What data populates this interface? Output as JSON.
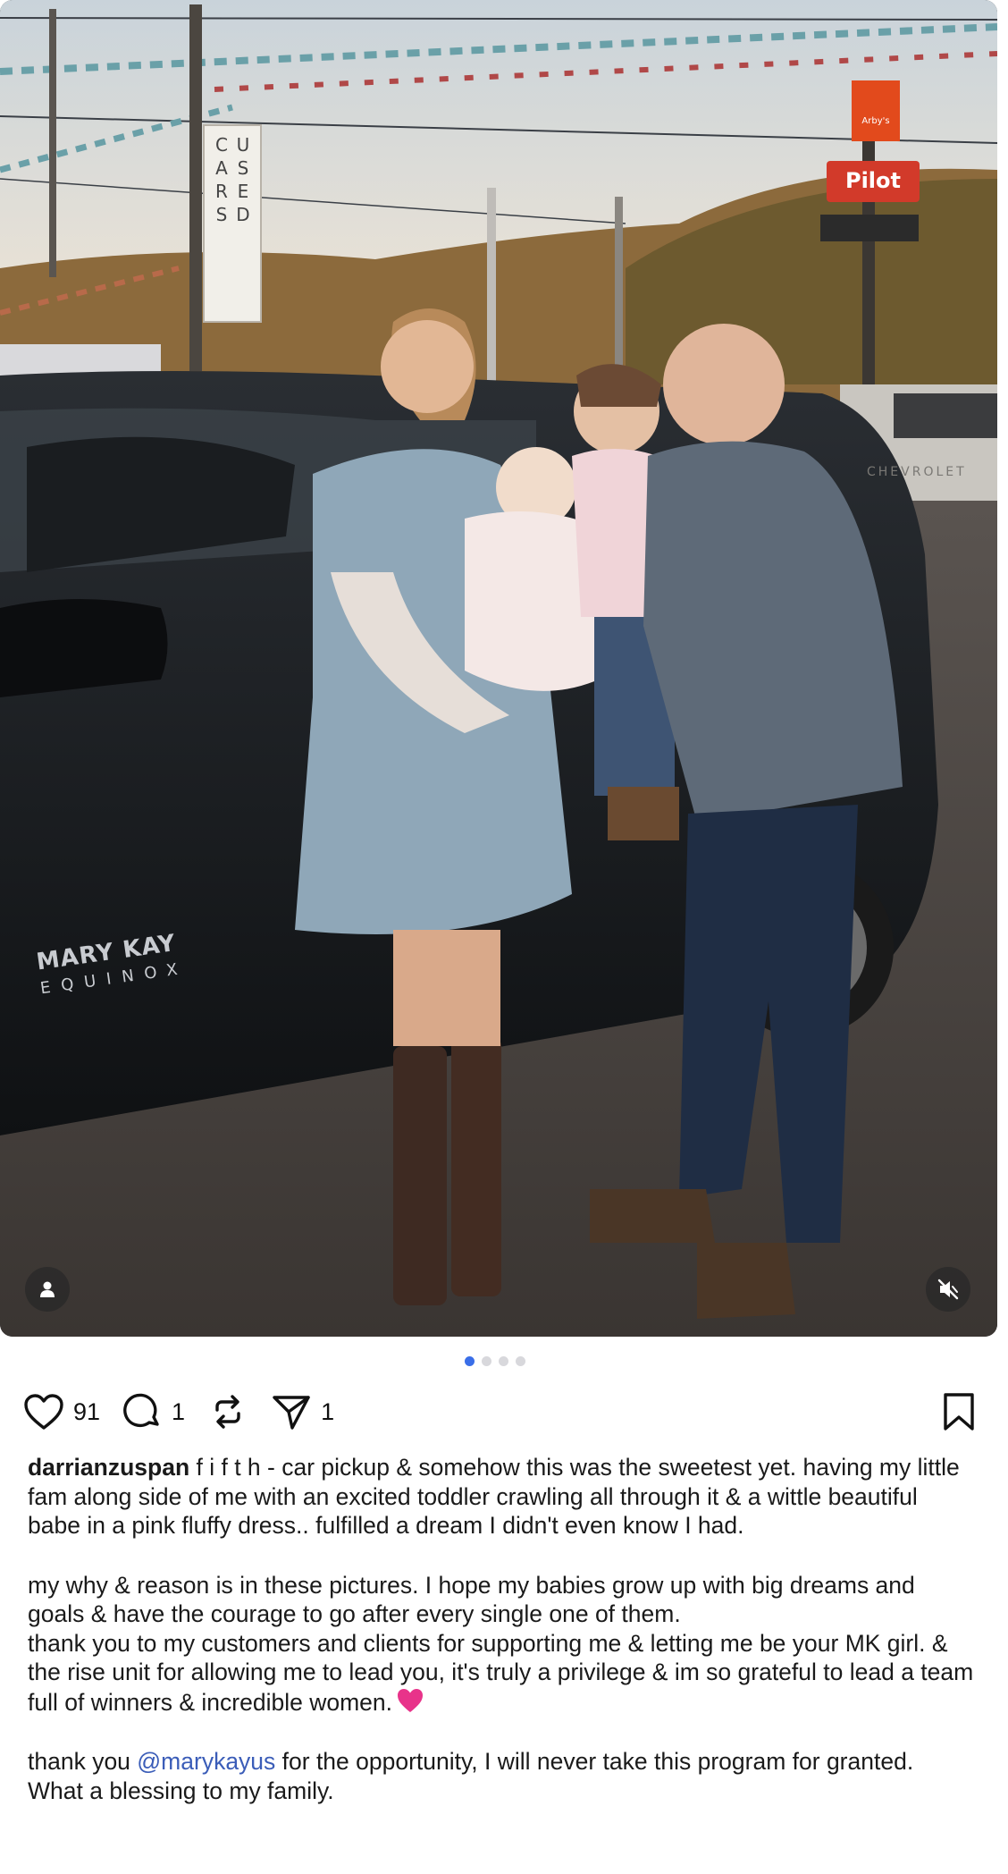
{
  "media": {
    "sign_text": "USED CARS",
    "arbys_label": "Arby's",
    "pilot_label": "Pilot",
    "truck_brand": "CHEVROLET",
    "car_logo_line1": "MARY KAY",
    "car_logo_line2": "EQUINOX",
    "carousel_dots": 4,
    "active_dot": 0
  },
  "actions": {
    "likes": "91",
    "comments": "1",
    "shares": "1"
  },
  "caption": {
    "username": "darrianzuspan",
    "p1_text": " f i f t h - car pickup & somehow this was the sweetest yet. having my little fam along side of me with an excited toddler crawling all through it & a wittle beautiful babe in a pink fluffy dress.. fulfilled a dream I didn't even know I had.",
    "p2": "my why & reason is in these pictures. I hope my babies grow up with big dreams and goals & have the courage to go after every single one of them.",
    "p3": "thank you to my customers and clients for supporting me & letting me be your MK girl. & the rise unit for allowing me to lead you, it's truly a privilege & im so grateful to lead a team full of winners & incredible women.",
    "p4_before": "thank you ",
    "p4_mention": "@marykayus",
    "p4_after": " for the opportunity, I will never take this program for granted. What a blessing to my family."
  },
  "colors": {
    "accent": "#3a6ee8",
    "mention": "#3b5db8",
    "emoji_heart": "#e8338a"
  }
}
